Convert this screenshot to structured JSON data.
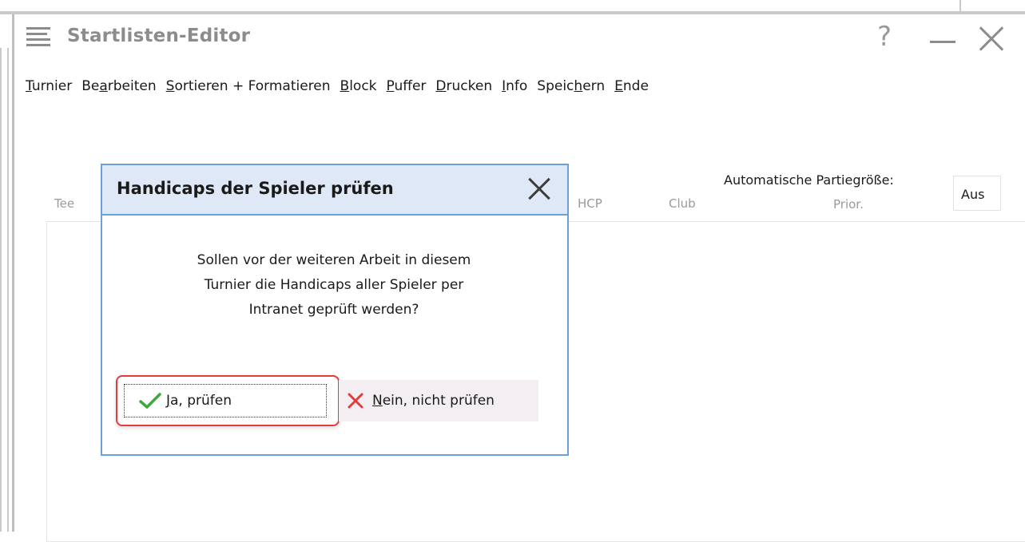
{
  "window": {
    "title": "Startlisten-Editor",
    "help_glyph": "?"
  },
  "menu": [
    {
      "pre": "",
      "key": "T",
      "post": "urnier"
    },
    {
      "pre": "Be",
      "key": "a",
      "post": "rbeiten"
    },
    {
      "pre": "",
      "key": "S",
      "post": "ortieren + Formatieren"
    },
    {
      "pre": "",
      "key": "B",
      "post": "lock"
    },
    {
      "pre": "",
      "key": "P",
      "post": "uffer"
    },
    {
      "pre": "",
      "key": "D",
      "post": "rucken"
    },
    {
      "pre": "",
      "key": "I",
      "post": "nfo"
    },
    {
      "pre": "Speic",
      "key": "h",
      "post": "ern"
    },
    {
      "pre": "",
      "key": "E",
      "post": "nde"
    }
  ],
  "list": {
    "col_tee": "Tee",
    "col_hcp": "HCP",
    "col_club": "Club",
    "col_prior": "Prior.",
    "auto_size_label": "Automatische Partiegröße:",
    "auto_size_value": "Aus"
  },
  "dialog": {
    "title": "Handicaps der Spieler prüfen",
    "message_lines": [
      "Sollen vor der weiteren Arbeit in diesem",
      "Turnier die Handicaps aller Spieler per",
      "Intranet geprüft werden?"
    ],
    "yes_key": "J",
    "yes_rest": "a, prüfen",
    "no_key": "N",
    "no_rest": "ein, nicht prüfen"
  },
  "colors": {
    "dialog_border": "#6d9fd8",
    "dialog_header_bg": "#dfe8f6",
    "highlight": "#e53b3b",
    "check": "#3aaa3a",
    "cross": "#e23c3c"
  }
}
